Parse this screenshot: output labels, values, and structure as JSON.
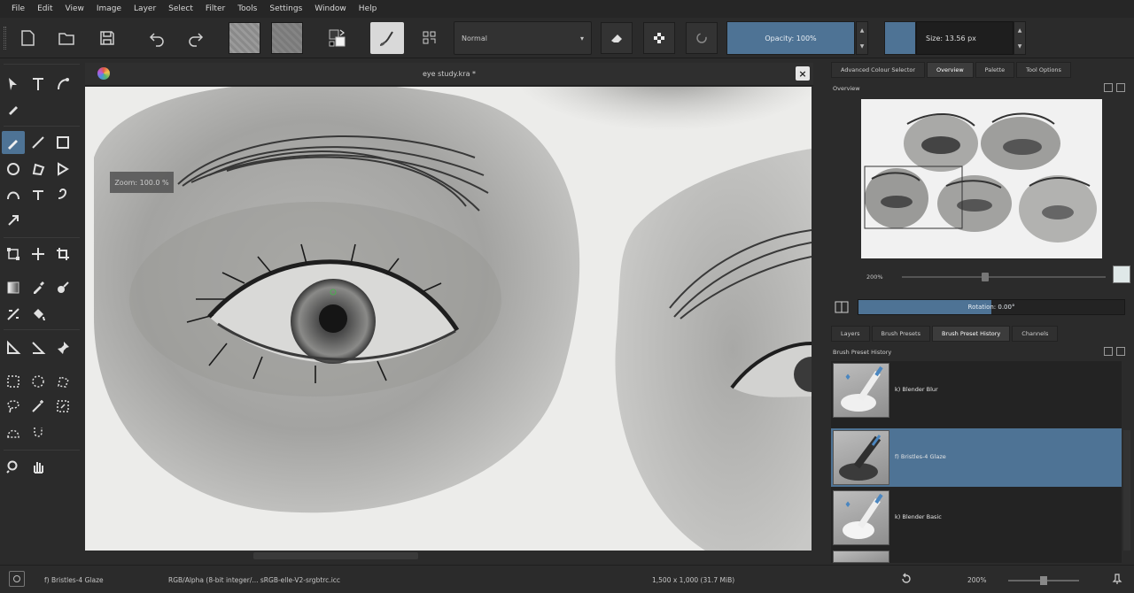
{
  "menu": [
    "File",
    "Edit",
    "View",
    "Image",
    "Layer",
    "Select",
    "Filter",
    "Tools",
    "Settings",
    "Window",
    "Help"
  ],
  "toolbar": {
    "blend_mode": "Normal",
    "opacity_label": "Opacity: 100%",
    "size_label": "Size: 13.56 px",
    "colors": {
      "accent": "#4e7395"
    }
  },
  "document": {
    "title": "eye study.kra *",
    "zoom_tooltip": "Zoom: 100.0 %"
  },
  "dock": {
    "top_tabs": [
      "Advanced Colour Selector",
      "Overview",
      "Palette",
      "Tool Options"
    ],
    "active_top_tab": "Overview",
    "overview_title": "Overview",
    "overview_zoom": "200%",
    "rotation_label": "Rotation: 0.00°",
    "bottom_tabs": [
      "Layers",
      "Brush Presets",
      "Brush Preset History",
      "Channels"
    ],
    "active_bottom_tab": "Brush Preset History",
    "history_title": "Brush Preset History",
    "presets": [
      {
        "name": "k) Blender Blur",
        "selected": false
      },
      {
        "name": "f) Bristles-4 Glaze",
        "selected": true
      },
      {
        "name": "k) Blender Basic",
        "selected": false
      }
    ]
  },
  "status": {
    "brush": "f) Bristles-4 Glaze",
    "color_space": "RGB/Alpha (8-bit integer/...  sRGB-elle-V2-srgbtrc.icc",
    "dimensions": "1,500 x 1,000 (31.7 MiB)",
    "zoom": "200%"
  }
}
